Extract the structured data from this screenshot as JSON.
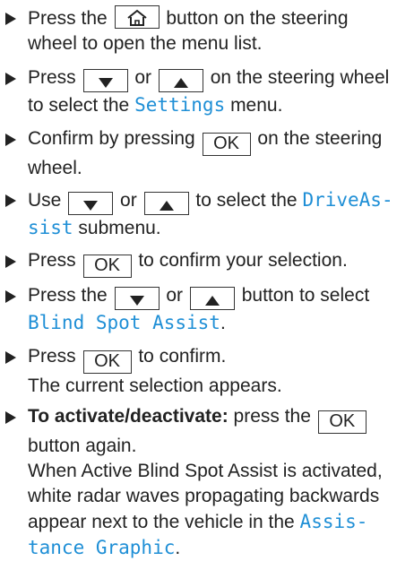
{
  "steps": [
    {
      "lines": [
        "Press the ",
        " button on the steering",
        "wheel to open the menu list."
      ]
    },
    {
      "lines": [
        "Press ",
        " or ",
        " on the steering wheel",
        "to select the ",
        "Settings",
        " menu."
      ]
    },
    {
      "lines": [
        "Confirm by pressing ",
        " on the steering",
        "wheel."
      ]
    },
    {
      "lines": [
        "Use ",
        " or ",
        " to select the ",
        "DriveAs-",
        "sist",
        " submenu."
      ]
    },
    {
      "lines": [
        "Press ",
        " to confirm your selection."
      ]
    },
    {
      "lines": [
        "Press the ",
        " or ",
        " button to select",
        "Blind Spot Assist",
        "."
      ]
    },
    {
      "lines": [
        "Press ",
        " to confirm.",
        "The current selection appears."
      ]
    },
    {
      "lines": [
        "To activate/deactivate:",
        " press the ",
        "button again.",
        "When Active Blind Spot Assist is activated,",
        "white radar waves propagating backwards",
        "appear next to the vehicle in the ",
        "Assis-",
        "tance Graphic",
        "."
      ]
    }
  ],
  "keys": {
    "ok": "OK",
    "home": "home-icon",
    "down": "down-triangle-icon",
    "up": "up-triangle-icon"
  },
  "colors": {
    "menu_term": "#1f8fd6",
    "text": "#222222"
  }
}
